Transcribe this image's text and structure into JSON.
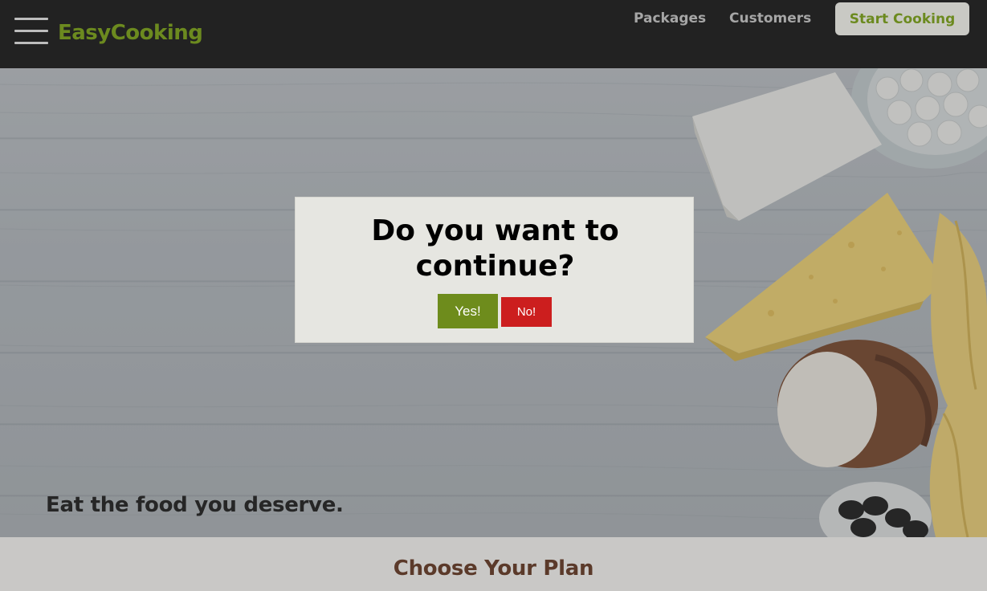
{
  "header": {
    "logo": "EasyCooking",
    "nav": [
      {
        "label": "Packages"
      },
      {
        "label": "Customers"
      }
    ],
    "cta_label": "Start Cooking"
  },
  "hero": {
    "tagline": "Eat the food you deserve."
  },
  "plans": {
    "title": "Choose Your Plan"
  },
  "modal": {
    "title": "Do you want to continue?",
    "yes_label": "Yes!",
    "no_label": "No!"
  },
  "colors": {
    "brand_green": "#6c8a1f",
    "header_bg": "#222222",
    "no_red": "#cc1e1e",
    "modal_bg": "#e6e6e1"
  },
  "icons": {
    "menu": "hamburger-icon"
  }
}
